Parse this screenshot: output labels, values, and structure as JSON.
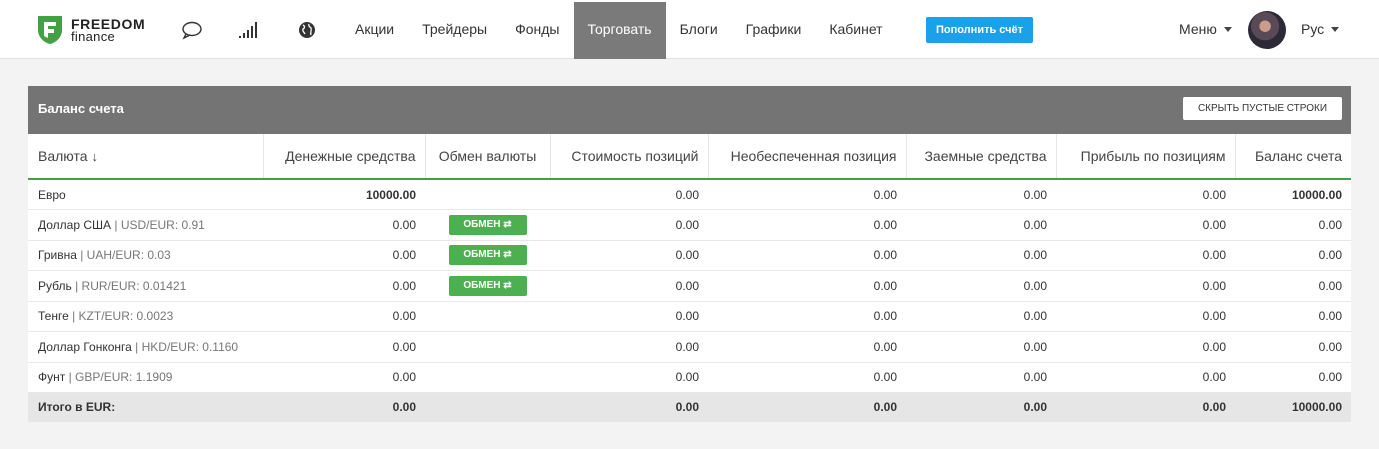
{
  "header": {
    "brand_line1": "FREEDOM",
    "brand_line2": "finance",
    "icons": [
      "chat-icon",
      "signal-icon",
      "globe-icon"
    ],
    "nav": [
      "Акции",
      "Трейдеры",
      "Фонды",
      "Торговать",
      "Блоги",
      "Графики",
      "Кабинет"
    ],
    "active_nav": "Торговать",
    "deposit_button": "Пополнить счёт",
    "menu_label": "Меню",
    "language": "Рус"
  },
  "panel": {
    "title": "Баланс счета",
    "hide_button": "СКРЫТЬ ПУСТЫЕ СТРОКИ",
    "columns": [
      "Валюта",
      "Денежные средства",
      "Обмен валюты",
      "Стоимость позиций",
      "Необеспеченная позиция",
      "Заемные средства",
      "Прибыль по позициям",
      "Баланс счета"
    ],
    "sort_indicator": "↓",
    "exchange_label": "ОБМЕН ⇄",
    "rows": [
      {
        "currency": "Евро",
        "rate": "",
        "cash": "10000.00",
        "exchange": false,
        "positions": "0.00",
        "unsecured": "0.00",
        "borrowed": "0.00",
        "profit": "0.00",
        "balance": "10000.00",
        "bold_cash": true
      },
      {
        "currency": "Доллар США",
        "rate": "| USD/EUR: 0.91",
        "cash": "0.00",
        "exchange": true,
        "positions": "0.00",
        "unsecured": "0.00",
        "borrowed": "0.00",
        "profit": "0.00",
        "balance": "0.00",
        "bold_cash": false
      },
      {
        "currency": "Гривна",
        "rate": "| UAH/EUR: 0.03",
        "cash": "0.00",
        "exchange": true,
        "positions": "0.00",
        "unsecured": "0.00",
        "borrowed": "0.00",
        "profit": "0.00",
        "balance": "0.00",
        "bold_cash": false
      },
      {
        "currency": "Рубль",
        "rate": "| RUR/EUR: 0.01421",
        "cash": "0.00",
        "exchange": true,
        "positions": "0.00",
        "unsecured": "0.00",
        "borrowed": "0.00",
        "profit": "0.00",
        "balance": "0.00",
        "bold_cash": false
      },
      {
        "currency": "Тенге",
        "rate": "| KZT/EUR: 0.0023",
        "cash": "0.00",
        "exchange": false,
        "positions": "0.00",
        "unsecured": "0.00",
        "borrowed": "0.00",
        "profit": "0.00",
        "balance": "0.00",
        "bold_cash": false
      },
      {
        "currency": "Доллар Гонконга",
        "rate": "| HKD/EUR: 0.1160",
        "cash": "0.00",
        "exchange": false,
        "positions": "0.00",
        "unsecured": "0.00",
        "borrowed": "0.00",
        "profit": "0.00",
        "balance": "0.00",
        "bold_cash": false
      },
      {
        "currency": "Фунт",
        "rate": "| GBP/EUR: 1.1909",
        "cash": "0.00",
        "exchange": false,
        "positions": "0.00",
        "unsecured": "0.00",
        "borrowed": "0.00",
        "profit": "0.00",
        "balance": "0.00",
        "bold_cash": false
      }
    ],
    "total": {
      "label": "Итого в EUR:",
      "cash": "0.00",
      "positions": "0.00",
      "unsecured": "0.00",
      "borrowed": "0.00",
      "profit": "0.00",
      "balance": "10000.00"
    }
  },
  "colors": {
    "accent_green": "#4caf50",
    "header_gray": "#747474",
    "deposit_blue": "#1aa1e8"
  }
}
